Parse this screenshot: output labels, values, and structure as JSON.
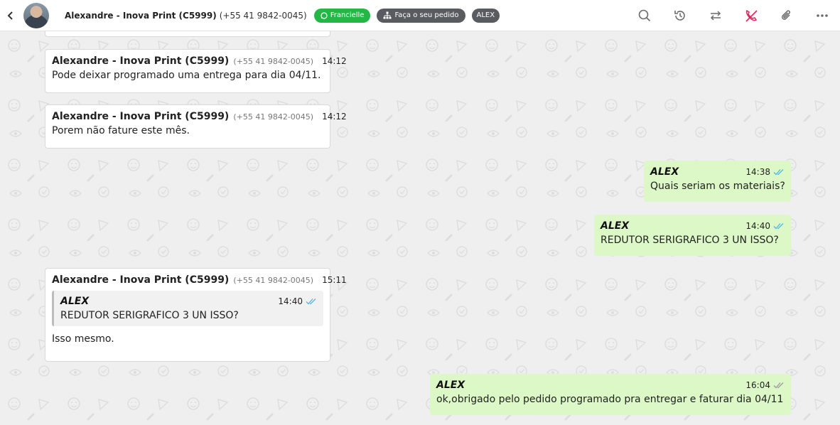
{
  "header": {
    "contact_name": "Alexandre - Inova Print (C5999)",
    "contact_phone": "(+55 41 9842-0045)",
    "tags": [
      "Francielle",
      "Faça o seu pedido",
      "ALEX"
    ],
    "icons": [
      "search-icon",
      "history-icon",
      "transfer-icon",
      "end-call-icon",
      "attach-icon",
      "more-icon"
    ]
  },
  "messages": [
    {
      "sender": "Alexandre - Inova Print (C5999)",
      "phone": "(+55 41 9842-0045)",
      "time": "14:12",
      "text": "Pode deixar programado uma entrega para dia 04/11."
    },
    {
      "sender": "Alexandre - Inova Print (C5999)",
      "phone": "(+55 41 9842-0045)",
      "time": "14:12",
      "text": "Porem não fature este mês."
    },
    {
      "sender": "ALEX",
      "time": "14:38",
      "text": "Quais seriam os materiais?"
    },
    {
      "sender": "ALEX",
      "time": "14:40",
      "text": "REDUTOR SERIGRAFICO 3 UN ISSO?"
    },
    {
      "sender": "Alexandre - Inova Print (C5999)",
      "phone": "(+55 41 9842-0045)",
      "time": "15:11",
      "quote": {
        "sender": "ALEX",
        "time": "14:40",
        "text": "REDUTOR SERIGRAFICO 3 UN ISSO?"
      },
      "text": "Isso mesmo."
    },
    {
      "sender": "ALEX",
      "time": "16:04",
      "text": "ok,obrigado pelo pedido programado pra entregar e faturar dia 04/11"
    }
  ],
  "colors": {
    "accent": "#25b745",
    "outgoing": "#dcf8c6",
    "read_ticks": "#4fb6ec",
    "end_call": "#e0245e"
  }
}
